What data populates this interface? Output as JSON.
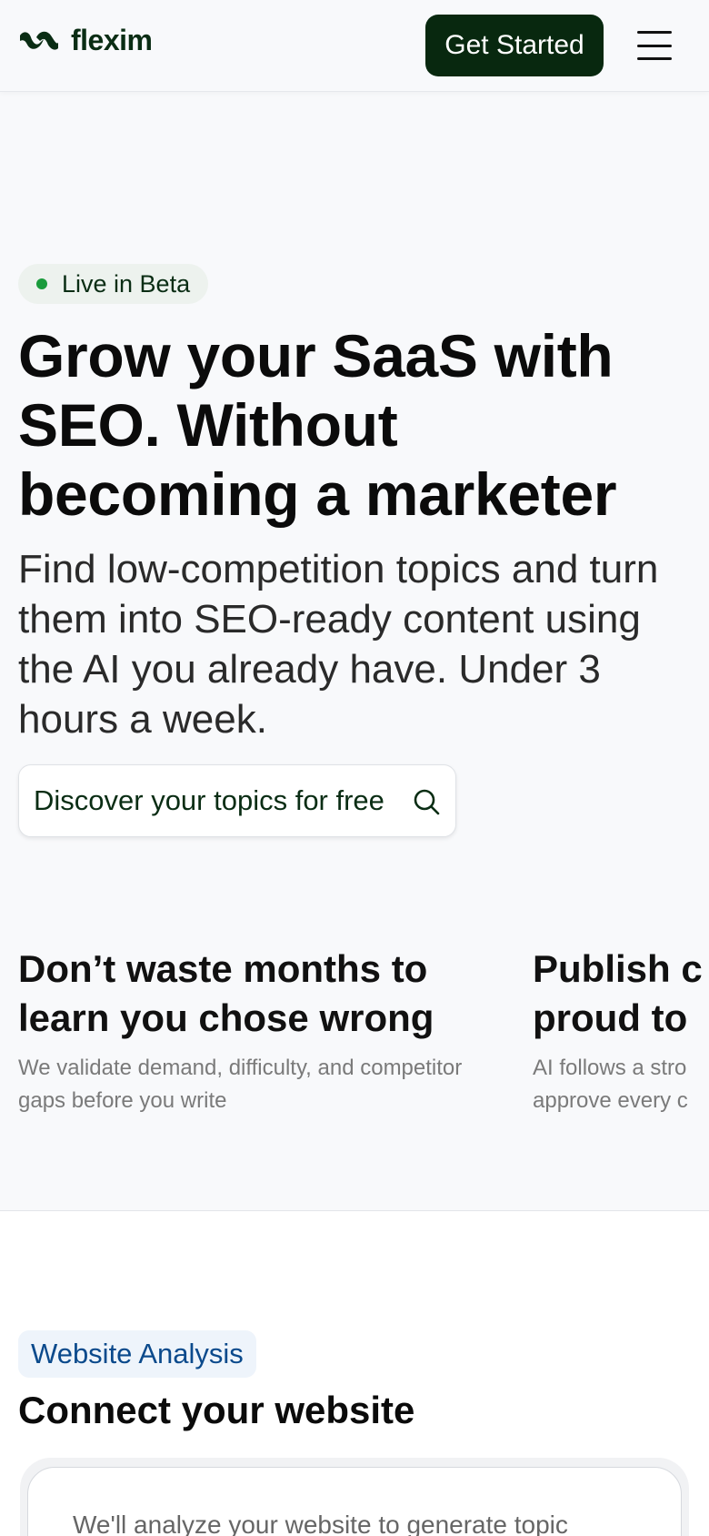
{
  "header": {
    "brand": "flexim",
    "cta_label": "Get Started",
    "menu_icon": "hamburger-menu-icon",
    "logo_icon": "flexim-logo-icon"
  },
  "hero": {
    "badge": "Live in Beta",
    "title": "Grow your SaaS with SEO. Without becoming a marketer",
    "subtitle": "Find low-competition topics and turn them into SEO-ready content using the AI you already have. Under 3 hours a week.",
    "discover_label": "Discover your topics for free",
    "discover_icon": "search-icon"
  },
  "features": [
    {
      "title_line1": "Don’t waste months to",
      "title_line2": "learn you chose wrong",
      "desc": "We validate demand, difficulty, and competitor gaps before you write"
    },
    {
      "title_line1": "Publish c",
      "title_line2": "proud to",
      "desc_line1": "AI follows a stro",
      "desc_line2": "approve every c"
    }
  ],
  "analysis": {
    "badge": "Website Analysis",
    "title": "Connect your website",
    "card_text": "We'll analyze your website to generate topic"
  },
  "colors": {
    "brand_dark": "#08280f",
    "badge_dot": "#1a9b3c",
    "analysis_blue": "#0b4a8c"
  }
}
